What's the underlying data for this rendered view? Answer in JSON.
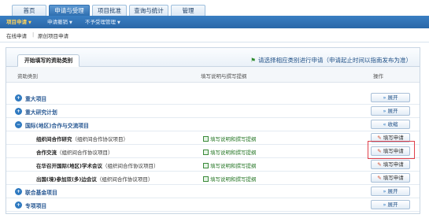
{
  "top_tabs": [
    {
      "label": "首页",
      "active": false
    },
    {
      "label": "申请与受理",
      "active": true
    },
    {
      "label": "项目批准",
      "active": false
    },
    {
      "label": "查询与统计",
      "active": false
    },
    {
      "label": "管理",
      "active": false
    }
  ],
  "sub_nav": [
    {
      "label": "项目申请",
      "active": true
    },
    {
      "label": "申请撤销",
      "active": false
    },
    {
      "label": "不予受理管理",
      "active": false
    }
  ],
  "sub_sub_nav": [
    {
      "label": "在线申请"
    },
    {
      "label": "原创项目申请"
    }
  ],
  "panel": {
    "tab_label": "开始填写的资助类别",
    "note": "请选择相应类别进行申请（申请起止时间以指南发布为准）"
  },
  "columns": {
    "category": "资助类别",
    "guide": "填写说明与撰写提纲",
    "action": "操作"
  },
  "rows": [
    {
      "type": "category",
      "label": "重大项目",
      "action": "展开",
      "expanded": false
    },
    {
      "type": "category",
      "label": "重大研究计划",
      "action": "展开",
      "expanded": false
    },
    {
      "type": "category",
      "label": "国际(地区)合作与交流项目",
      "action": "收缩",
      "expanded": true
    },
    {
      "type": "item",
      "name": "组织间合作研究",
      "note": "（组织间合作协议项目）",
      "guide": "填写说明和撰写提纲",
      "action": "填写申请"
    },
    {
      "type": "item",
      "name": "合作交流",
      "note": "（组织间合作协议项目）",
      "guide": "填写说明和撰写提纲",
      "action": "填写申请"
    },
    {
      "type": "item",
      "name": "在华召开国际(地区)学术会议",
      "note": "（组织间合作协议项目）",
      "guide": "填写说明和撰写提纲",
      "action": "填写申请"
    },
    {
      "type": "item",
      "name": "出国(境)参加双(多)边会议",
      "note": "（组织间合作协议项目）",
      "guide": "填写说明和撰写提纲",
      "action": "填写申请"
    },
    {
      "type": "category",
      "label": "联合基金项目",
      "action": "展开",
      "expanded": false
    },
    {
      "type": "category",
      "label": "专项项目",
      "action": "展开",
      "expanded": false
    }
  ],
  "colors": {
    "accent": "#2f6fb0",
    "highlight": "#e0404a"
  }
}
